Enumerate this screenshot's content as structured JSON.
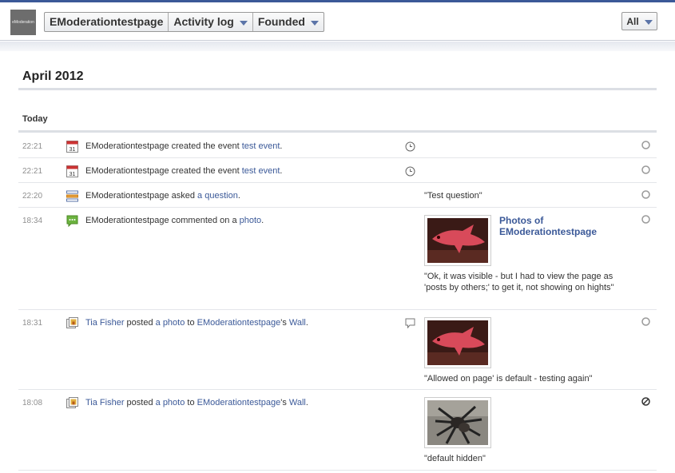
{
  "header": {
    "logo_text": "eModeration",
    "crumbs": [
      "EModerationtestpage",
      "Activity log",
      "Founded"
    ],
    "filter_label": "All"
  },
  "log": {
    "month": "April 2012",
    "day": "Today",
    "rows": [
      {
        "time": "22:21",
        "icon": "calendar-icon",
        "actor": "EModerationtestpage",
        "verb": " created the event ",
        "object": "test event",
        "end": ".",
        "mid_icon": "clock-icon"
      },
      {
        "time": "22:21",
        "icon": "calendar-icon",
        "actor": "EModerationtestpage",
        "verb": " created the event ",
        "object": "test event",
        "end": ".",
        "mid_icon": "clock-icon"
      },
      {
        "time": "22:20",
        "icon": "question-icon",
        "actor": "EModerationtestpage",
        "verb": " asked ",
        "object": "a question",
        "end": ".",
        "detail": "\"Test question\""
      },
      {
        "time": "18:34",
        "icon": "comment-icon",
        "actor": "EModerationtestpage",
        "verb": " commented on a ",
        "object": "photo",
        "end": ".",
        "album_title": "Photos of EModerationtestpage",
        "caption": "\"Ok, it was visible - but I had to view the page as 'posts by others;' to get it, not showing on hights\""
      },
      {
        "time": "18:31",
        "icon": "photo-post-icon",
        "actor": "Tia Fisher",
        "verb": " posted ",
        "object": "a photo",
        "to": " to ",
        "target": "EModerationtestpage",
        "poss": "'s ",
        "wall": "Wall",
        "end": ".",
        "mid_icon": "comment-bubble-icon",
        "caption": "\"Allowed on page' is default - testing again\""
      },
      {
        "time": "18:08",
        "icon": "photo-post-icon",
        "actor": "Tia Fisher",
        "verb": " posted ",
        "object": "a photo",
        "to": " to ",
        "target": "EModerationtestpage",
        "poss": "'s ",
        "wall": "Wall",
        "end": ".",
        "caption": "\"default hidden\"",
        "status": "hidden"
      }
    ]
  }
}
